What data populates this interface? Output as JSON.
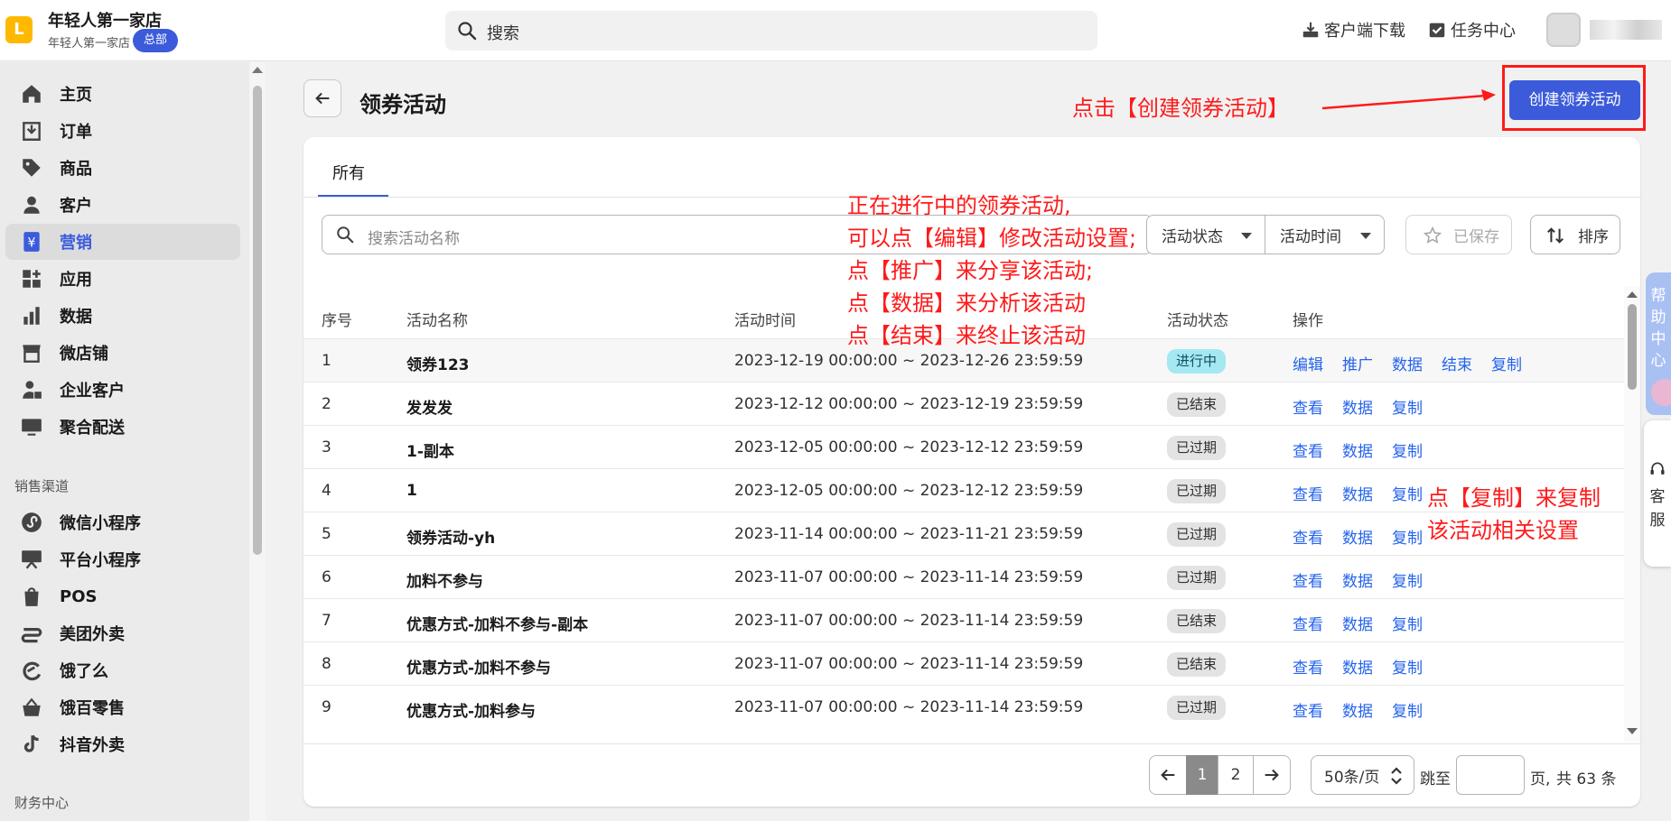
{
  "header": {
    "logo_glyph": "L",
    "store_name": "年轻人第一家店",
    "store_sub": "年轻人第一家店",
    "store_badge": "总部",
    "search_placeholder": "搜索",
    "download_label": "客户端下载",
    "tasks_label": "任务中心"
  },
  "sidebar": {
    "items": [
      {
        "label": "主页",
        "icon": "home-icon"
      },
      {
        "label": "订单",
        "icon": "order-icon"
      },
      {
        "label": "商品",
        "icon": "tag-icon"
      },
      {
        "label": "客户",
        "icon": "person-icon"
      },
      {
        "label": "营销",
        "icon": "yen-icon",
        "active": true
      },
      {
        "label": "应用",
        "icon": "apps-icon"
      },
      {
        "label": "数据",
        "icon": "bar-chart-icon"
      },
      {
        "label": "微店铺",
        "icon": "store-icon"
      },
      {
        "label": "企业客户",
        "icon": "enterprise-icon"
      },
      {
        "label": "聚合配送",
        "icon": "monitor-icon"
      }
    ],
    "channels_title": "销售渠道",
    "channels": [
      {
        "label": "微信小程序",
        "icon": "wechat-miniapp-icon"
      },
      {
        "label": "平台小程序",
        "icon": "platform-miniapp-icon"
      },
      {
        "label": "POS",
        "icon": "pos-bag-icon"
      },
      {
        "label": "美团外卖",
        "icon": "meituan-icon"
      },
      {
        "label": "饿了么",
        "icon": "eleme-icon"
      },
      {
        "label": "饿百零售",
        "icon": "basket-icon"
      },
      {
        "label": "抖音外卖",
        "icon": "tiktok-icon"
      }
    ],
    "finance_title": "财务中心"
  },
  "page": {
    "title": "领券活动",
    "create_button": "创建领券活动"
  },
  "tabs": [
    {
      "label": "所有"
    }
  ],
  "filters": {
    "search_placeholder": "搜索活动名称",
    "status_label": "活动状态",
    "time_label": "活动时间",
    "saved_label": "已保存",
    "sort_label": "排序"
  },
  "table": {
    "headers": [
      "序号",
      "活动名称",
      "活动时间",
      "活动状态",
      "操作"
    ],
    "rows": [
      {
        "no": "1",
        "name": "领券123",
        "time": "2023-12-19 00:00:00 ~ 2023-12-26 23:59:59",
        "status": "进行中",
        "live": true,
        "actions": [
          "编辑",
          "推广",
          "数据",
          "结束",
          "复制"
        ]
      },
      {
        "no": "2",
        "name": "发发发",
        "time": "2023-12-12 00:00:00 ~ 2023-12-19 23:59:59",
        "status": "已结束",
        "actions": [
          "查看",
          "数据",
          "复制"
        ]
      },
      {
        "no": "3",
        "name": "1-副本",
        "time": "2023-12-05 00:00:00 ~ 2023-12-12 23:59:59",
        "status": "已过期",
        "actions": [
          "查看",
          "数据",
          "复制"
        ]
      },
      {
        "no": "4",
        "name": "1",
        "time": "2023-12-05 00:00:00 ~ 2023-12-12 23:59:59",
        "status": "已过期",
        "actions": [
          "查看",
          "数据",
          "复制"
        ]
      },
      {
        "no": "5",
        "name": "领券活动-yh",
        "time": "2023-11-14 00:00:00 ~ 2023-11-21 23:59:59",
        "status": "已过期",
        "actions": [
          "查看",
          "数据",
          "复制"
        ]
      },
      {
        "no": "6",
        "name": "加料不参与",
        "time": "2023-11-07 00:00:00 ~ 2023-11-14 23:59:59",
        "status": "已过期",
        "actions": [
          "查看",
          "数据",
          "复制"
        ]
      },
      {
        "no": "7",
        "name": "优惠方式-加料不参与-副本",
        "time": "2023-11-07 00:00:00 ~ 2023-11-14 23:59:59",
        "status": "已结束",
        "actions": [
          "查看",
          "数据",
          "复制"
        ]
      },
      {
        "no": "8",
        "name": "优惠方式-加料不参与",
        "time": "2023-11-07 00:00:00 ~ 2023-11-14 23:59:59",
        "status": "已结束",
        "actions": [
          "查看",
          "数据",
          "复制"
        ]
      },
      {
        "no": "9",
        "name": "优惠方式-加料参与",
        "time": "2023-11-07 00:00:00 ~ 2023-11-14 23:59:59",
        "status": "已过期",
        "actions": [
          "查看",
          "数据",
          "复制"
        ]
      }
    ]
  },
  "pagination": {
    "pages": [
      "1",
      "2"
    ],
    "current": "1",
    "page_size": "50条/页",
    "jump_label": "跳至",
    "page_unit": "页,",
    "total": "共 63 条"
  },
  "right_helpers": {
    "help_text": "帮助中心",
    "service_text": "客服"
  },
  "annotations": {
    "create_hint": "点击【创建领券活动】",
    "edit_hint": [
      "正在进行中的领券活动,",
      "可以点【编辑】修改活动设置;",
      "点【推广】来分享该活动;",
      "点【数据】来分析该活动",
      "点【结束】来终止该活动"
    ],
    "copy_hint": [
      "点【复制】来复制",
      "该活动相关设置"
    ]
  },
  "colors": {
    "accent": "#3b5bdb",
    "annotation_red": "#ff1a1a",
    "link_blue": "#2463eb",
    "live_badge": "#a4e8f2"
  }
}
